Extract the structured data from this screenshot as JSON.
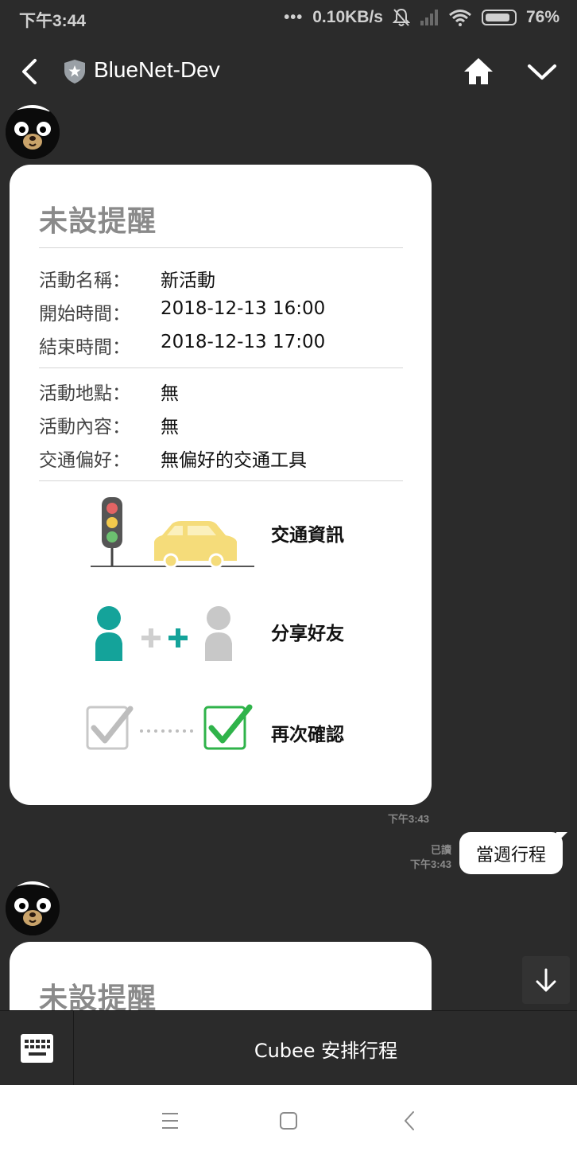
{
  "status_bar": {
    "time": "下午3:44",
    "net_speed": "0.10KB/s",
    "battery": "76%"
  },
  "header": {
    "title": "BlueNet-Dev"
  },
  "cards": [
    {
      "title": "未設提醒",
      "fields": [
        {
          "label": "活動名稱：",
          "value": "新活動"
        },
        {
          "label": "開始時間：",
          "value": "2018-12-13 16:00"
        },
        {
          "label": "結束時間：",
          "value": "2018-12-13 17:00"
        },
        {
          "label": "活動地點：",
          "value": "無"
        },
        {
          "label": "活動內容：",
          "value": "無"
        },
        {
          "label": "交通偏好：",
          "value": "無偏好的交通工具"
        }
      ],
      "features": [
        {
          "label": "交通資訊",
          "icon": "traffic-car-icon"
        },
        {
          "label": "分享好友",
          "icon": "share-friend-icon"
        },
        {
          "label": "再次確認",
          "icon": "confirm-check-icon"
        }
      ],
      "timestamp": "下午3:43"
    },
    {
      "title": "未設提醒"
    }
  ],
  "user_message": {
    "read_status": "已讀",
    "timestamp": "下午3:43",
    "text": "當週行程"
  },
  "bottom_bar": {
    "action_label": "Cubee 安排行程"
  },
  "colors": {
    "background": "#2b2b2b",
    "card": "#ffffff",
    "teal": "#14a39a",
    "green_check": "#2fb34a"
  }
}
